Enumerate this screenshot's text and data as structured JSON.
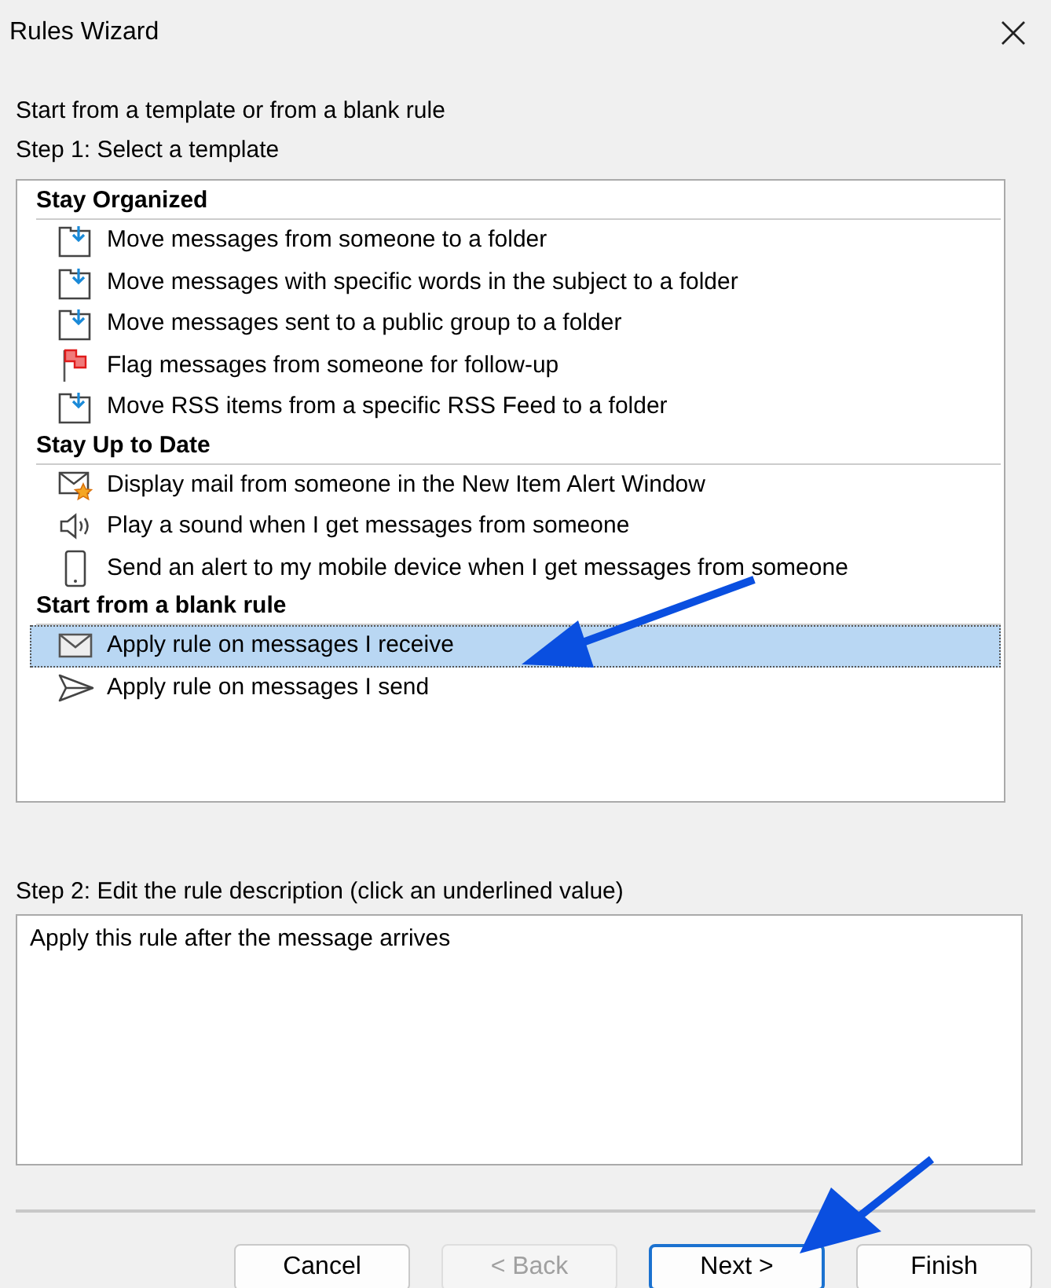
{
  "window": {
    "title": "Rules Wizard"
  },
  "intro": "Start from a template or from a blank rule",
  "step1": {
    "label": "Step 1: Select a template",
    "groups": [
      {
        "title": "Stay Organized",
        "items": [
          {
            "kind": "move",
            "label": "Move messages from someone to a folder",
            "selected": false
          },
          {
            "kind": "move",
            "label": "Move messages with specific words in the subject to a folder",
            "selected": false
          },
          {
            "kind": "move",
            "label": "Move messages sent to a public group to a folder",
            "selected": false
          },
          {
            "kind": "flag",
            "label": "Flag messages from someone for follow-up",
            "selected": false
          },
          {
            "kind": "move",
            "label": "Move RSS items from a specific RSS Feed to a folder",
            "selected": false
          }
        ]
      },
      {
        "title": "Stay Up to Date",
        "items": [
          {
            "kind": "alert",
            "label": "Display mail from someone in the New Item Alert Window",
            "selected": false
          },
          {
            "kind": "sound",
            "label": "Play a sound when I get messages from someone",
            "selected": false
          },
          {
            "kind": "mobile",
            "label": "Send an alert to my mobile device when I get messages from someone",
            "selected": false
          }
        ]
      },
      {
        "title": "Start from a blank rule",
        "items": [
          {
            "kind": "receive",
            "label": "Apply rule on messages I receive",
            "selected": true
          },
          {
            "kind": "send",
            "label": "Apply rule on messages I send",
            "selected": false
          }
        ]
      }
    ]
  },
  "step2": {
    "label": "Step 2: Edit the rule description (click an underlined value)",
    "description": "Apply this rule after the message arrives"
  },
  "buttons": [
    {
      "label": "Cancel",
      "disabled": false,
      "default": false
    },
    {
      "label": "< Back",
      "disabled": true,
      "default": false
    },
    {
      "label": "Next >",
      "disabled": false,
      "default": true
    },
    {
      "label": "Finish",
      "disabled": false,
      "default": false
    }
  ]
}
